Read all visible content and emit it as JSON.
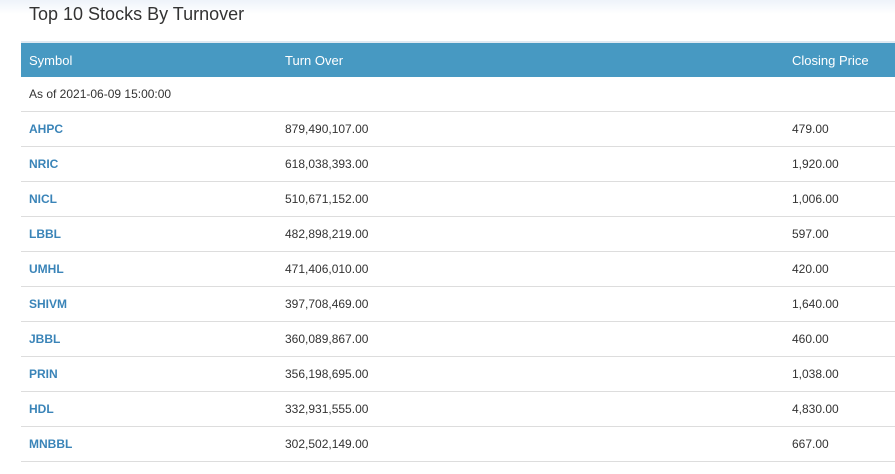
{
  "title": "Top 10 Stocks By Turnover",
  "colors": {
    "header_bg": "#4799c2",
    "link": "#3a84b8",
    "text": "#333333",
    "border": "#dddddd"
  },
  "table": {
    "headers": {
      "symbol": "Symbol",
      "turnover": "Turn Over",
      "closing_price": "Closing Price"
    },
    "as_of": "As of 2021-06-09 15:00:00",
    "rows": [
      {
        "symbol": "AHPC",
        "turnover": "879,490,107.00",
        "closing_price": "479.00"
      },
      {
        "symbol": "NRIC",
        "turnover": "618,038,393.00",
        "closing_price": "1,920.00"
      },
      {
        "symbol": "NICL",
        "turnover": "510,671,152.00",
        "closing_price": "1,006.00"
      },
      {
        "symbol": "LBBL",
        "turnover": "482,898,219.00",
        "closing_price": "597.00"
      },
      {
        "symbol": "UMHL",
        "turnover": "471,406,010.00",
        "closing_price": "420.00"
      },
      {
        "symbol": "SHIVM",
        "turnover": "397,708,469.00",
        "closing_price": "1,640.00"
      },
      {
        "symbol": "JBBL",
        "turnover": "360,089,867.00",
        "closing_price": "460.00"
      },
      {
        "symbol": "PRIN",
        "turnover": "356,198,695.00",
        "closing_price": "1,038.00"
      },
      {
        "symbol": "HDL",
        "turnover": "332,931,555.00",
        "closing_price": "4,830.00"
      },
      {
        "symbol": "MNBBL",
        "turnover": "302,502,149.00",
        "closing_price": "667.00"
      }
    ]
  }
}
